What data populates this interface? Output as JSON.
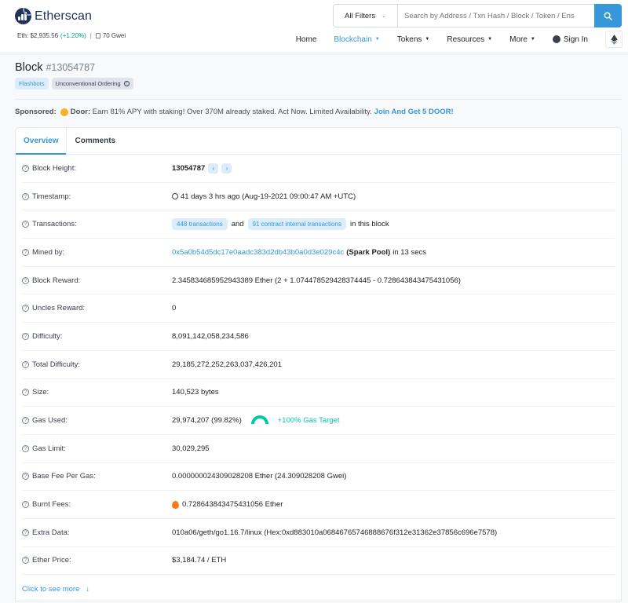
{
  "header": {
    "brand": "Etherscan",
    "eth_price_label": "Eth: $2,935.56",
    "eth_price_change": "(+1.20%)",
    "separator": "|",
    "gas_price": "70 Gwei",
    "search": {
      "filter": "All Filters",
      "placeholder": "Search by Address / Txn Hash / Block / Token / Ens"
    },
    "nav": {
      "home": "Home",
      "blockchain": "Blockchain",
      "tokens": "Tokens",
      "resources": "Resources",
      "more": "More",
      "signin": "Sign In"
    }
  },
  "page": {
    "title": "Block",
    "block_number": "#13054787",
    "tags": [
      "Flashbots",
      "Unconventional Ordering"
    ],
    "sponsored": {
      "label": "Sponsored:",
      "brand": "Door:",
      "text": "Earn 81% APY with staking! Over 370M already staked. Act Now. Limited Availability.",
      "cta": "Join And Get 5 DOOR!"
    }
  },
  "tabs": [
    "Overview",
    "Comments"
  ],
  "overview": {
    "block_height": {
      "label": "Block Height:",
      "value": "13054787"
    },
    "timestamp": {
      "label": "Timestamp:",
      "value": "41 days 3 hrs ago (Aug-19-2021 09:00:47 AM +UTC)"
    },
    "transactions": {
      "label": "Transactions:",
      "txns": "448 transactions",
      "and": "and",
      "internal": "91 contract internal transactions",
      "suffix": "in this block"
    },
    "mined_by": {
      "label": "Mined by:",
      "address": "0x5a0b54d5dc17e0aadc383d2db43b0a0d3e029c4c",
      "pool": "(Spark Pool)",
      "time": "in 13 secs"
    },
    "block_reward": {
      "label": "Block Reward:",
      "value": "2.345834685952943389 Ether (2 + 1.074478529428374445 - 0.728643843475431056)"
    },
    "uncles_reward": {
      "label": "Uncles Reward:",
      "value": "0"
    },
    "difficulty": {
      "label": "Difficulty:",
      "value": "8,091,142,058,234,586"
    },
    "total_difficulty": {
      "label": "Total Difficulty:",
      "value": "29,185,272,252,263,037,426,201"
    },
    "size": {
      "label": "Size:",
      "value": "140,523 bytes"
    },
    "gas_used": {
      "label": "Gas Used:",
      "value": "29,974,207 (99.82%)",
      "target": "+100% Gas Target",
      "gauge_percent": 99.82
    },
    "gas_limit": {
      "label": "Gas Limit:",
      "value": "30,029,295"
    },
    "base_fee": {
      "label": "Base Fee Per Gas:",
      "value": "0.000000024309028208 Ether (24.309028208 Gwei)"
    },
    "burnt_fees": {
      "label": "Burnt Fees:",
      "value": "0.728643843475431056 Ether"
    },
    "extra_data": {
      "label": "Extra Data:",
      "value": "010a06/geth/go1.16.7/linux (Hex:0xd883010a06846765746888676f312e31362e37856c696e7578)"
    },
    "ether_price": {
      "label": "Ether Price:",
      "value": "$3,184.74 / ETH"
    },
    "see_more": "Click to see more"
  },
  "colors": {
    "accent": "#3498db",
    "brand": "#21325b",
    "success": "#00c9a7"
  }
}
